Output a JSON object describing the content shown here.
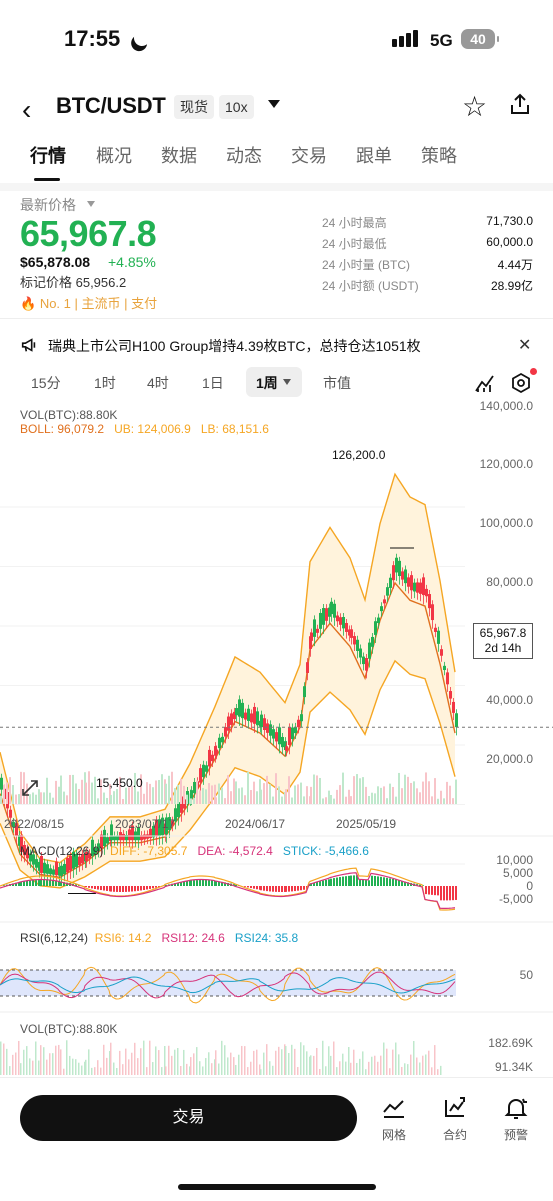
{
  "status": {
    "time": "17:55",
    "network": "5G",
    "battery": "40"
  },
  "header": {
    "pair": "BTC/USDT",
    "market_tag": "现货",
    "leverage_tag": "10x"
  },
  "tabs": [
    "行情",
    "概况",
    "数据",
    "动态",
    "交易",
    "跟单",
    "策略"
  ],
  "price": {
    "latest_label": "最新价格",
    "last": "65,967.8",
    "usd": "$65,878.08",
    "change": "+4.85%",
    "mark_label": "标记价格 65,956.2",
    "badges": "No. 1 | 主流币 | 支付"
  },
  "stats": [
    {
      "label": "24 小时最高",
      "value": "71,730.0"
    },
    {
      "label": "24 小时最低",
      "value": "60,000.0"
    },
    {
      "label": "24 小时量 (BTC)",
      "value": "4.44万"
    },
    {
      "label": "24 小时额 (USDT)",
      "value": "28.99亿"
    }
  ],
  "news": "瑞典上市公司H100 Group增持4.39枚BTC，总持仓达1051枚",
  "intervals": {
    "items": [
      "15分",
      "1时",
      "4时",
      "1日"
    ],
    "active": "1周",
    "extra": "市值"
  },
  "chart": {
    "vol_label": "VOL(BTC):88.80K",
    "boll": {
      "name": "BOLL: 96,079.2",
      "ub": "UB: 124,006.9",
      "lb": "LB: 68,151.6"
    },
    "y_axis": [
      "140,000.0",
      "120,000.0",
      "100,000.0",
      "80,000.0",
      "40,000.0",
      "20,000.0"
    ],
    "high_marker": "126,200.0",
    "low_marker": "15,450.0",
    "last_price_box": "65,967.8",
    "countdown": "2d 14h",
    "dates": [
      "2022/08/15",
      "2023/07/17",
      "2024/06/17",
      "2025/05/19"
    ],
    "colors": {
      "up": "#22b153",
      "down": "#f23645",
      "boll_mid": "#e0701e",
      "boll_band": "#f5a623"
    }
  },
  "macd": {
    "name": "MACD(12,26,9)",
    "diff": "DIFF: -7,305.7",
    "dea": "DEA: -4,572.4",
    "stick": "STICK: -5,466.6",
    "axis": [
      "10,000",
      "5,000",
      "0",
      "-5,000"
    ]
  },
  "rsi": {
    "name": "RSI(6,12,24)",
    "rsi6": "RSI6: 14.2",
    "rsi12": "RSI12: 24.6",
    "rsi24": "RSI24: 35.8",
    "axis": "50"
  },
  "volume": {
    "label": "VOL(BTC):88.80K",
    "axis": [
      "182.69K",
      "91.34K"
    ]
  },
  "bottom": {
    "trade": "交易",
    "grid": "网格",
    "contract": "合约",
    "alert": "预警"
  }
}
